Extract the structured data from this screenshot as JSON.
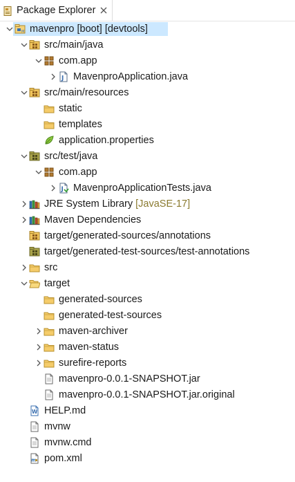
{
  "tab": {
    "title": "Package Explorer",
    "icon": "package-explorer-icon",
    "close_icon": "close-icon"
  },
  "tree": [
    {
      "id": "project",
      "label": "mavenpro [boot] [devtools]",
      "decoration": "",
      "level": 0,
      "twisty": "expanded",
      "icon": "project",
      "selected": true
    },
    {
      "id": "src-main-java",
      "label": "src/main/java",
      "decoration": "",
      "level": 1,
      "twisty": "expanded",
      "icon": "source-folder"
    },
    {
      "id": "pkg-com-app",
      "label": "com.app",
      "decoration": "",
      "level": 2,
      "twisty": "expanded",
      "icon": "package"
    },
    {
      "id": "mavenpro-application-java",
      "label": "MavenproApplication.java",
      "decoration": "",
      "level": 3,
      "twisty": "collapsed",
      "icon": "java-file"
    },
    {
      "id": "src-main-resources",
      "label": "src/main/resources",
      "decoration": "",
      "level": 1,
      "twisty": "expanded",
      "icon": "source-folder"
    },
    {
      "id": "static",
      "label": "static",
      "decoration": "",
      "level": 2,
      "twisty": "none",
      "icon": "folder"
    },
    {
      "id": "templates",
      "label": "templates",
      "decoration": "",
      "level": 2,
      "twisty": "none",
      "icon": "folder"
    },
    {
      "id": "application-properties",
      "label": "application.properties",
      "decoration": "",
      "level": 2,
      "twisty": "none",
      "icon": "properties-file"
    },
    {
      "id": "src-test-java",
      "label": "src/test/java",
      "decoration": "",
      "level": 1,
      "twisty": "expanded",
      "icon": "test-source-folder"
    },
    {
      "id": "pkg-com-app-test",
      "label": "com.app",
      "decoration": "",
      "level": 2,
      "twisty": "expanded",
      "icon": "package"
    },
    {
      "id": "mavenpro-application-tests-java",
      "label": "MavenproApplicationTests.java",
      "decoration": "",
      "level": 3,
      "twisty": "collapsed",
      "icon": "java-test-file"
    },
    {
      "id": "jre-system-library",
      "label": "JRE System Library",
      "decoration": " [JavaSE-17]",
      "level": 1,
      "twisty": "collapsed",
      "icon": "library"
    },
    {
      "id": "maven-dependencies",
      "label": "Maven Dependencies",
      "decoration": "",
      "level": 1,
      "twisty": "collapsed",
      "icon": "library"
    },
    {
      "id": "target-generated-sources-annotations",
      "label": "target/generated-sources/annotations",
      "decoration": "",
      "level": 1,
      "twisty": "none",
      "icon": "source-folder"
    },
    {
      "id": "target-generated-test-sources",
      "label": "target/generated-test-sources/test-annotations",
      "decoration": "",
      "level": 1,
      "twisty": "none",
      "icon": "test-source-folder"
    },
    {
      "id": "src",
      "label": "src",
      "decoration": "",
      "level": 1,
      "twisty": "collapsed",
      "icon": "folder"
    },
    {
      "id": "target",
      "label": "target",
      "decoration": "",
      "level": 1,
      "twisty": "expanded",
      "icon": "folder-open"
    },
    {
      "id": "generated-sources",
      "label": "generated-sources",
      "decoration": "",
      "level": 2,
      "twisty": "none",
      "icon": "folder"
    },
    {
      "id": "generated-test-sources",
      "label": "generated-test-sources",
      "decoration": "",
      "level": 2,
      "twisty": "none",
      "icon": "folder"
    },
    {
      "id": "maven-archiver",
      "label": "maven-archiver",
      "decoration": "",
      "level": 2,
      "twisty": "collapsed",
      "icon": "folder"
    },
    {
      "id": "maven-status",
      "label": "maven-status",
      "decoration": "",
      "level": 2,
      "twisty": "collapsed",
      "icon": "folder"
    },
    {
      "id": "surefire-reports",
      "label": "surefire-reports",
      "decoration": "",
      "level": 2,
      "twisty": "collapsed",
      "icon": "folder"
    },
    {
      "id": "snapshot-jar",
      "label": "mavenpro-0.0.1-SNAPSHOT.jar",
      "decoration": "",
      "level": 2,
      "twisty": "none",
      "icon": "file"
    },
    {
      "id": "snapshot-jar-original",
      "label": "mavenpro-0.0.1-SNAPSHOT.jar.original",
      "decoration": "",
      "level": 2,
      "twisty": "none",
      "icon": "file"
    },
    {
      "id": "help-md",
      "label": "HELP.md",
      "decoration": "",
      "level": 1,
      "twisty": "none",
      "icon": "md-file"
    },
    {
      "id": "mvnw",
      "label": "mvnw",
      "decoration": "",
      "level": 1,
      "twisty": "none",
      "icon": "file"
    },
    {
      "id": "mvnw-cmd",
      "label": "mvnw.cmd",
      "decoration": "",
      "level": 1,
      "twisty": "none",
      "icon": "file"
    },
    {
      "id": "pom-xml",
      "label": "pom.xml",
      "decoration": "",
      "level": 1,
      "twisty": "none",
      "icon": "xml-file"
    }
  ],
  "colors": {
    "selection": "#cce8ff",
    "decoration": "#8a7a2f",
    "folder": "#e8b64c",
    "package": "#a0702a",
    "java_blue": "#3a6fb0"
  }
}
